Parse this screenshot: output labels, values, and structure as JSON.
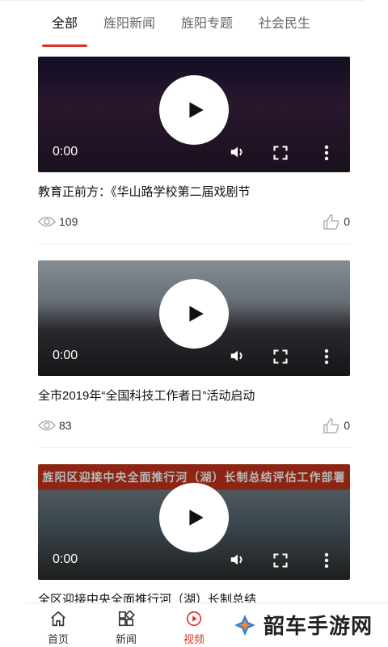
{
  "tabs": [
    {
      "label": "全部"
    },
    {
      "label": "旌阳新闻"
    },
    {
      "label": "旌阳专题"
    },
    {
      "label": "社会民生"
    }
  ],
  "videos": [
    {
      "title": "教育正前方：《华山路学校第二届戏剧节",
      "time": "0:00",
      "views": "109",
      "likes": "0"
    },
    {
      "title": "全市2019年“全国科技工作者日”活动启动",
      "time": "0:00",
      "views": "83",
      "likes": "0"
    },
    {
      "title": "全区迎接中央全面推行河（湖）长制总结",
      "time": "0:00",
      "banner": "旌阳区迎接中央全面推行河（湖）长制总结评估工作部署会"
    }
  ],
  "nav": [
    {
      "label": "首页"
    },
    {
      "label": "新闻"
    },
    {
      "label": "视频"
    }
  ],
  "watermark": "韶车手游网",
  "colors": {
    "accent": "#d9342b"
  }
}
